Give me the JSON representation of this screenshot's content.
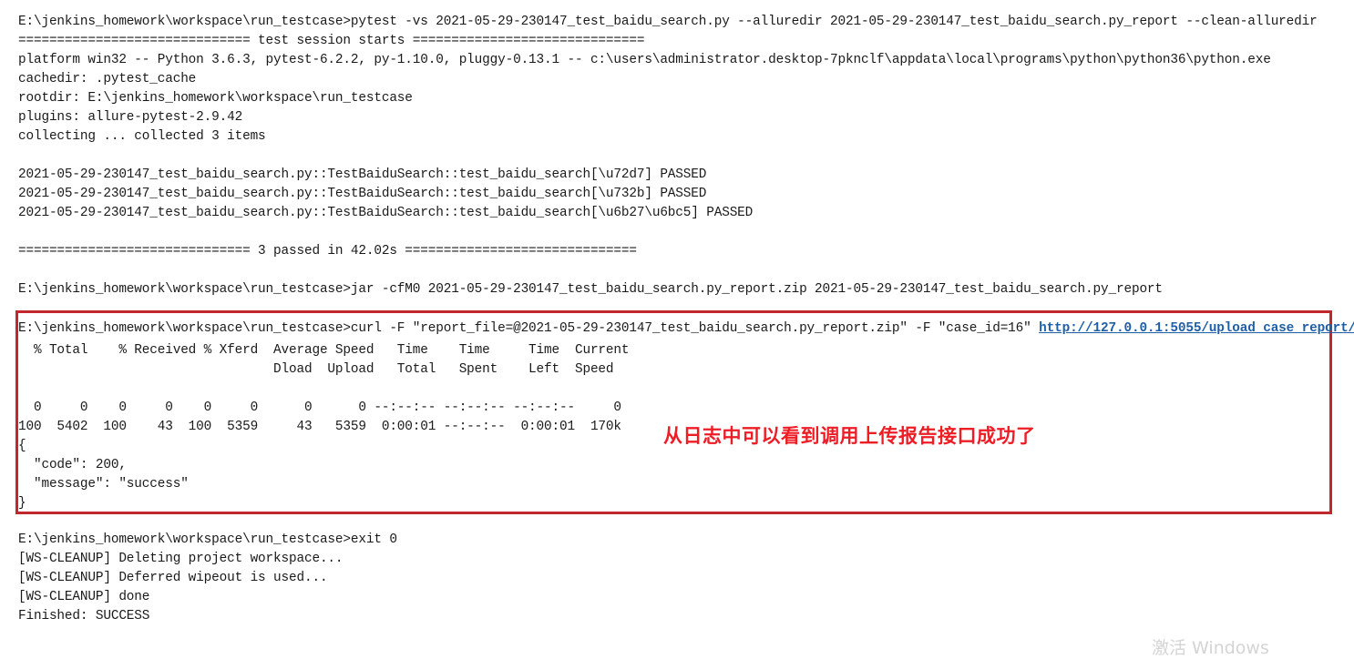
{
  "meta": {
    "app": "jenkins-console-output",
    "background_color": "#ffffff",
    "text_color": "#1a1a1a",
    "link_color": "#1f5fa8",
    "annotation_color": "#ee1c25",
    "highlight_box_color": "#c1272d",
    "watermark_color": "#d4d4d4"
  },
  "console": {
    "lines": [
      "E:\\jenkins_homework\\workspace\\run_testcase>pytest -vs 2021-05-29-230147_test_baidu_search.py --alluredir 2021-05-29-230147_test_baidu_search.py_report --clean-alluredir",
      "============================== test session starts ==============================",
      "platform win32 -- Python 3.6.3, pytest-6.2.2, py-1.10.0, pluggy-0.13.1 -- c:\\users\\administrator.desktop-7pknclf\\appdata\\local\\programs\\python\\python36\\python.exe",
      "cachedir: .pytest_cache",
      "rootdir: E:\\jenkins_homework\\workspace\\run_testcase",
      "plugins: allure-pytest-2.9.42",
      "collecting ... collected 3 items",
      "",
      "2021-05-29-230147_test_baidu_search.py::TestBaiduSearch::test_baidu_search[\\u72d7] PASSED",
      "2021-05-29-230147_test_baidu_search.py::TestBaiduSearch::test_baidu_search[\\u732b] PASSED",
      "2021-05-29-230147_test_baidu_search.py::TestBaiduSearch::test_baidu_search[\\u6b27\\u6bc5] PASSED",
      "",
      "============================== 3 passed in 42.02s ==============================",
      "",
      "E:\\jenkins_homework\\workspace\\run_testcase>jar -cfM0 2021-05-29-230147_test_baidu_search.py_report.zip 2021-05-29-230147_test_baidu_search.py_report"
    ]
  },
  "curl_block": {
    "command_prefix": "E:\\jenkins_homework\\workspace\\run_testcase>curl -F ″report_file=@2021-05-29-230147_test_baidu_search.py_report.zip″ -F ″case_id=16″ ",
    "command_url": "http://127.0.0.1:5055/upload_case_report/",
    "header_row_1": "  % Total    % Received % Xferd  Average Speed   Time    Time     Time  Current",
    "header_row_2": "                                 Dload  Upload   Total   Spent    Left  Speed",
    "blank_row": "",
    "stats_row_1": "  0     0    0     0    0     0      0      0 --:--:-- --:--:-- --:--:--     0",
    "stats_row_2": "100  5402  100    43  100  5359     43   5359  0:00:01 --:--:--  0:00:01  170k",
    "response_lines": [
      "{",
      "  ″code″: 200,",
      "  ″message″: ″success″",
      "}"
    ]
  },
  "annotation": {
    "text": "从日志中可以看到调用上传报告接口成功了"
  },
  "footer": {
    "lines": [
      "E:\\jenkins_homework\\workspace\\run_testcase>exit 0",
      "[WS-CLEANUP] Deleting project workspace...",
      "[WS-CLEANUP] Deferred wipeout is used...",
      "[WS-CLEANUP] done",
      "Finished: SUCCESS"
    ]
  },
  "watermark": {
    "text": "激活 Windows"
  }
}
